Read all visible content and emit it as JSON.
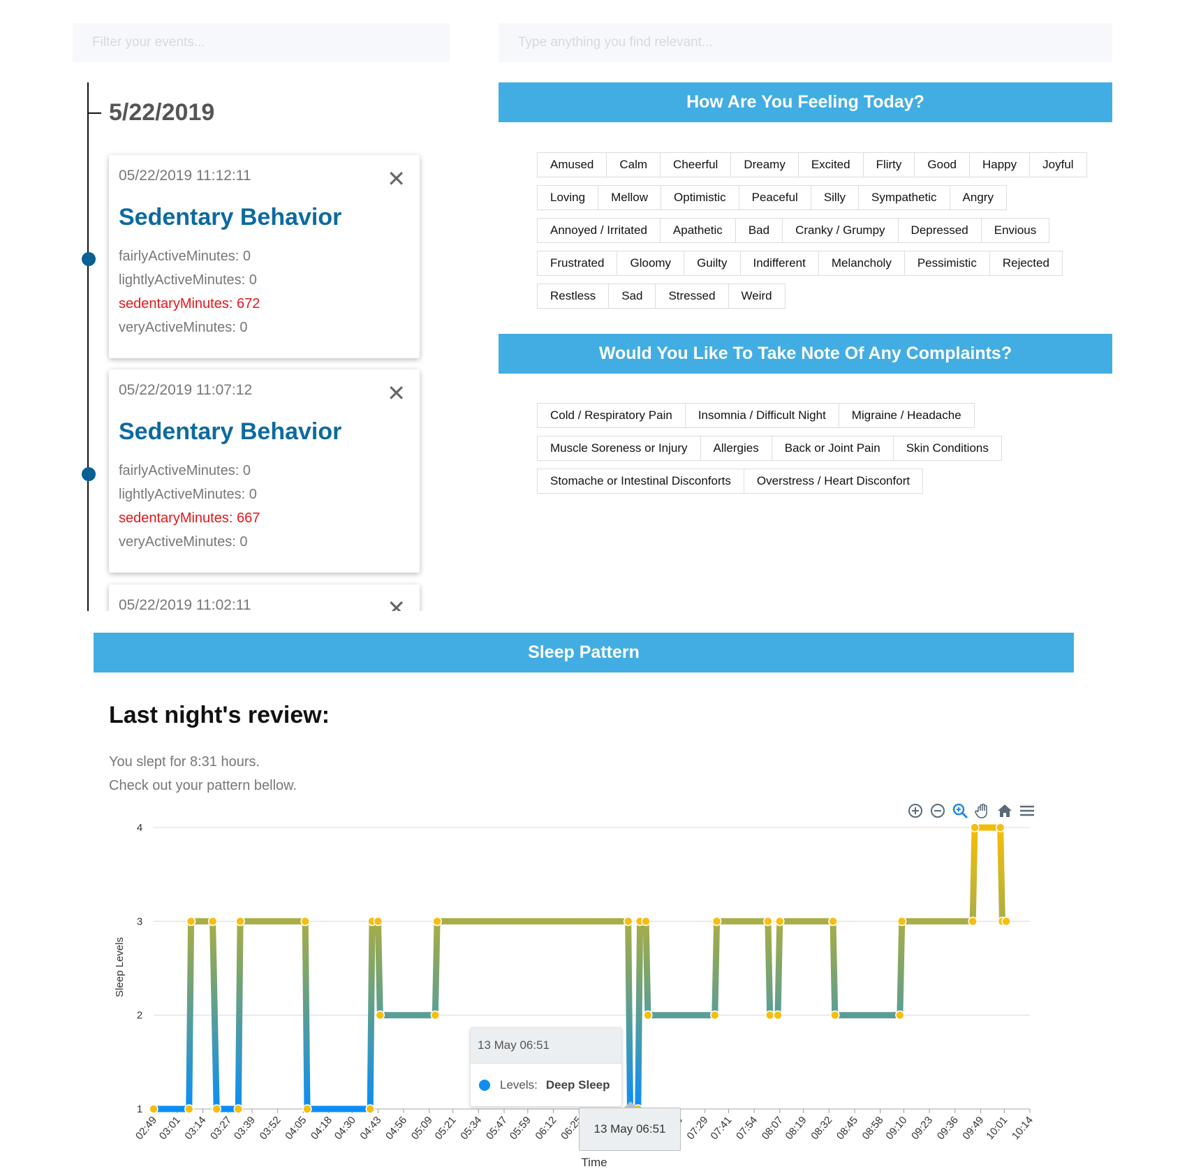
{
  "filters": {
    "events_placeholder": "Filter your events...",
    "relevant_placeholder": "Type anything you find relevant..."
  },
  "timeline": {
    "date": "5/22/2019",
    "events": [
      {
        "time": "05/22/2019 11:12:11",
        "close": "✕",
        "title": "Sedentary Behavior",
        "metrics": [
          {
            "text": "fairlyActiveMinutes: 0",
            "alert": false
          },
          {
            "text": "lightlyActiveMinutes: 0",
            "alert": false
          },
          {
            "text": "sedentaryMinutes: 672",
            "alert": true
          },
          {
            "text": "veryActiveMinutes: 0",
            "alert": false
          }
        ]
      },
      {
        "time": "05/22/2019 11:07:12",
        "close": "✕",
        "title": "Sedentary Behavior",
        "metrics": [
          {
            "text": "fairlyActiveMinutes: 0",
            "alert": false
          },
          {
            "text": "lightlyActiveMinutes: 0",
            "alert": false
          },
          {
            "text": "sedentaryMinutes: 667",
            "alert": true
          },
          {
            "text": "veryActiveMinutes: 0",
            "alert": false
          }
        ]
      },
      {
        "time": "05/22/2019 11:02:11",
        "close": "✕",
        "title": "",
        "metrics": []
      }
    ]
  },
  "feelings": {
    "title": "How Are You Feeling Today?",
    "rows": [
      [
        "Amused",
        "Calm",
        "Cheerful",
        "Dreamy",
        "Excited",
        "Flirty",
        "Good",
        "Happy",
        "Joyful"
      ],
      [
        "Loving",
        "Mellow",
        "Optimistic",
        "Peaceful",
        "Silly",
        "Sympathetic",
        "Angry"
      ],
      [
        "Annoyed / Irritated",
        "Apathetic",
        "Bad",
        "Cranky / Grumpy",
        "Depressed",
        "Envious"
      ],
      [
        "Frustrated",
        "Gloomy",
        "Guilty",
        "Indifferent",
        "Melancholy",
        "Pessimistic",
        "Rejected"
      ],
      [
        "Restless",
        "Sad",
        "Stressed",
        "Weird"
      ]
    ]
  },
  "complaints": {
    "title": "Would You Like To Take Note Of Any Complaints?",
    "rows": [
      [
        "Cold / Respiratory Pain",
        "Insomnia / Difficult Night",
        "Migraine / Headache"
      ],
      [
        "Muscle Soreness or Injury",
        "Allergies",
        "Back or Joint Pain",
        "Skin Conditions"
      ],
      [
        "Stomache or Intestinal Disconforts",
        "Overstress / Heart Disconfort"
      ]
    ]
  },
  "sleep": {
    "header": "Sleep Pattern",
    "review_title": "Last night's review:",
    "line1": "You slept for 8:31 hours.",
    "line2": "Check out your pattern bellow.",
    "tooltip": {
      "date": "13 May 06:51",
      "label": "Levels:",
      "value": "Deep Sleep"
    },
    "xaxis_tooltip": "13 May 06:51",
    "toolbar_icons": [
      "zoom-in-icon",
      "zoom-out-icon",
      "selection-zoom-icon",
      "pan-icon",
      "home-icon",
      "menu-icon"
    ]
  },
  "chart_data": {
    "type": "line",
    "ylabel": "Sleep Levels",
    "xlabel": "Time",
    "ylim": [
      1,
      4
    ],
    "yticks": [
      1,
      2,
      3,
      4
    ],
    "xticks": [
      "02:49",
      "03:01",
      "03:14",
      "03:27",
      "03:39",
      "03:52",
      "04:05",
      "04:18",
      "04:30",
      "04:43",
      "04:56",
      "05:09",
      "05:21",
      "05:34",
      "05:47",
      "05:59",
      "06:12",
      "06:25",
      "06:38",
      "06:51",
      "07:04",
      "07:16",
      "07:29",
      "07:41",
      "07:54",
      "08:07",
      "08:19",
      "08:32",
      "08:45",
      "08:58",
      "09:10",
      "09:23",
      "09:36",
      "09:49",
      "10:01",
      "10:14"
    ],
    "series": [
      {
        "name": "Levels",
        "points": [
          [
            "02:49",
            1
          ],
          [
            "03:07",
            1
          ],
          [
            "03:08",
            3
          ],
          [
            "03:19",
            3
          ],
          [
            "03:21",
            1
          ],
          [
            "03:32",
            1
          ],
          [
            "03:33",
            3
          ],
          [
            "04:06",
            3
          ],
          [
            "04:07",
            1
          ],
          [
            "04:39",
            1
          ],
          [
            "04:40",
            3
          ],
          [
            "04:43",
            3
          ],
          [
            "04:44",
            2
          ],
          [
            "05:12",
            2
          ],
          [
            "05:13",
            3
          ],
          [
            "06:50",
            3
          ],
          [
            "06:51",
            1
          ],
          [
            "06:55",
            1
          ],
          [
            "06:56",
            3
          ],
          [
            "06:59",
            3
          ],
          [
            "07:00",
            2
          ],
          [
            "07:34",
            2
          ],
          [
            "07:35",
            3
          ],
          [
            "08:01",
            3
          ],
          [
            "08:02",
            2
          ],
          [
            "08:06",
            2
          ],
          [
            "08:07",
            3
          ],
          [
            "08:34",
            3
          ],
          [
            "08:35",
            2
          ],
          [
            "09:08",
            2
          ],
          [
            "09:09",
            3
          ],
          [
            "09:45",
            3
          ],
          [
            "09:46",
            4
          ],
          [
            "09:59",
            4
          ],
          [
            "10:00",
            3
          ],
          [
            "10:02",
            3
          ]
        ]
      }
    ]
  }
}
